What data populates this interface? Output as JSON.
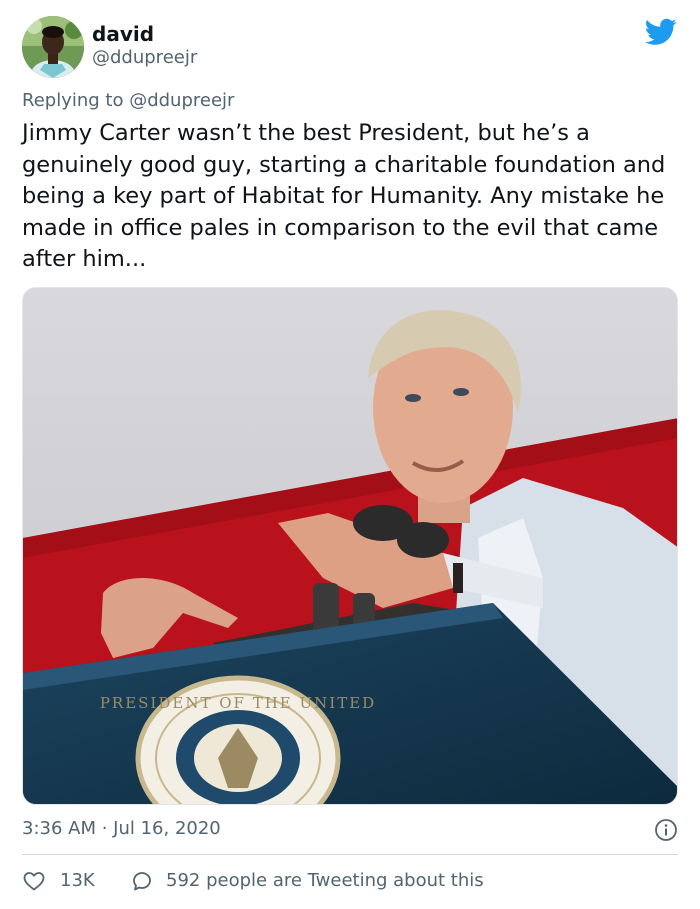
{
  "author": {
    "display_name": "david",
    "handle": "@ddupreejr",
    "avatar": "profile-photo"
  },
  "replying": {
    "prefix": "Replying to ",
    "handle": "@ddupreejr"
  },
  "tweet": {
    "text": "Jimmy Carter wasn’t the best President, but he’s a genuinely good guy, starting a charitable foundation and being a key part of Habitat for Humanity. Any mistake he made in office pales in comparison to the evil that came after him...",
    "image": "photo of a man speaking at a podium with the presidential seal in front of a red and white backdrop",
    "seal_text": "PRESIDENT OF THE UNITED",
    "timestamp": "3:36 AM · Jul 16, 2020"
  },
  "stats": {
    "likes": "13K",
    "conversation": "592 people are Tweeting about this"
  },
  "icons": {
    "brand": "twitter-bird-icon",
    "info": "info-icon",
    "like": "heart-icon",
    "reply": "speech-bubble-icon"
  },
  "colors": {
    "brand": "#1d9bf0",
    "text": "#0f1419",
    "secondary": "#536471",
    "divider": "#cfd9de"
  }
}
